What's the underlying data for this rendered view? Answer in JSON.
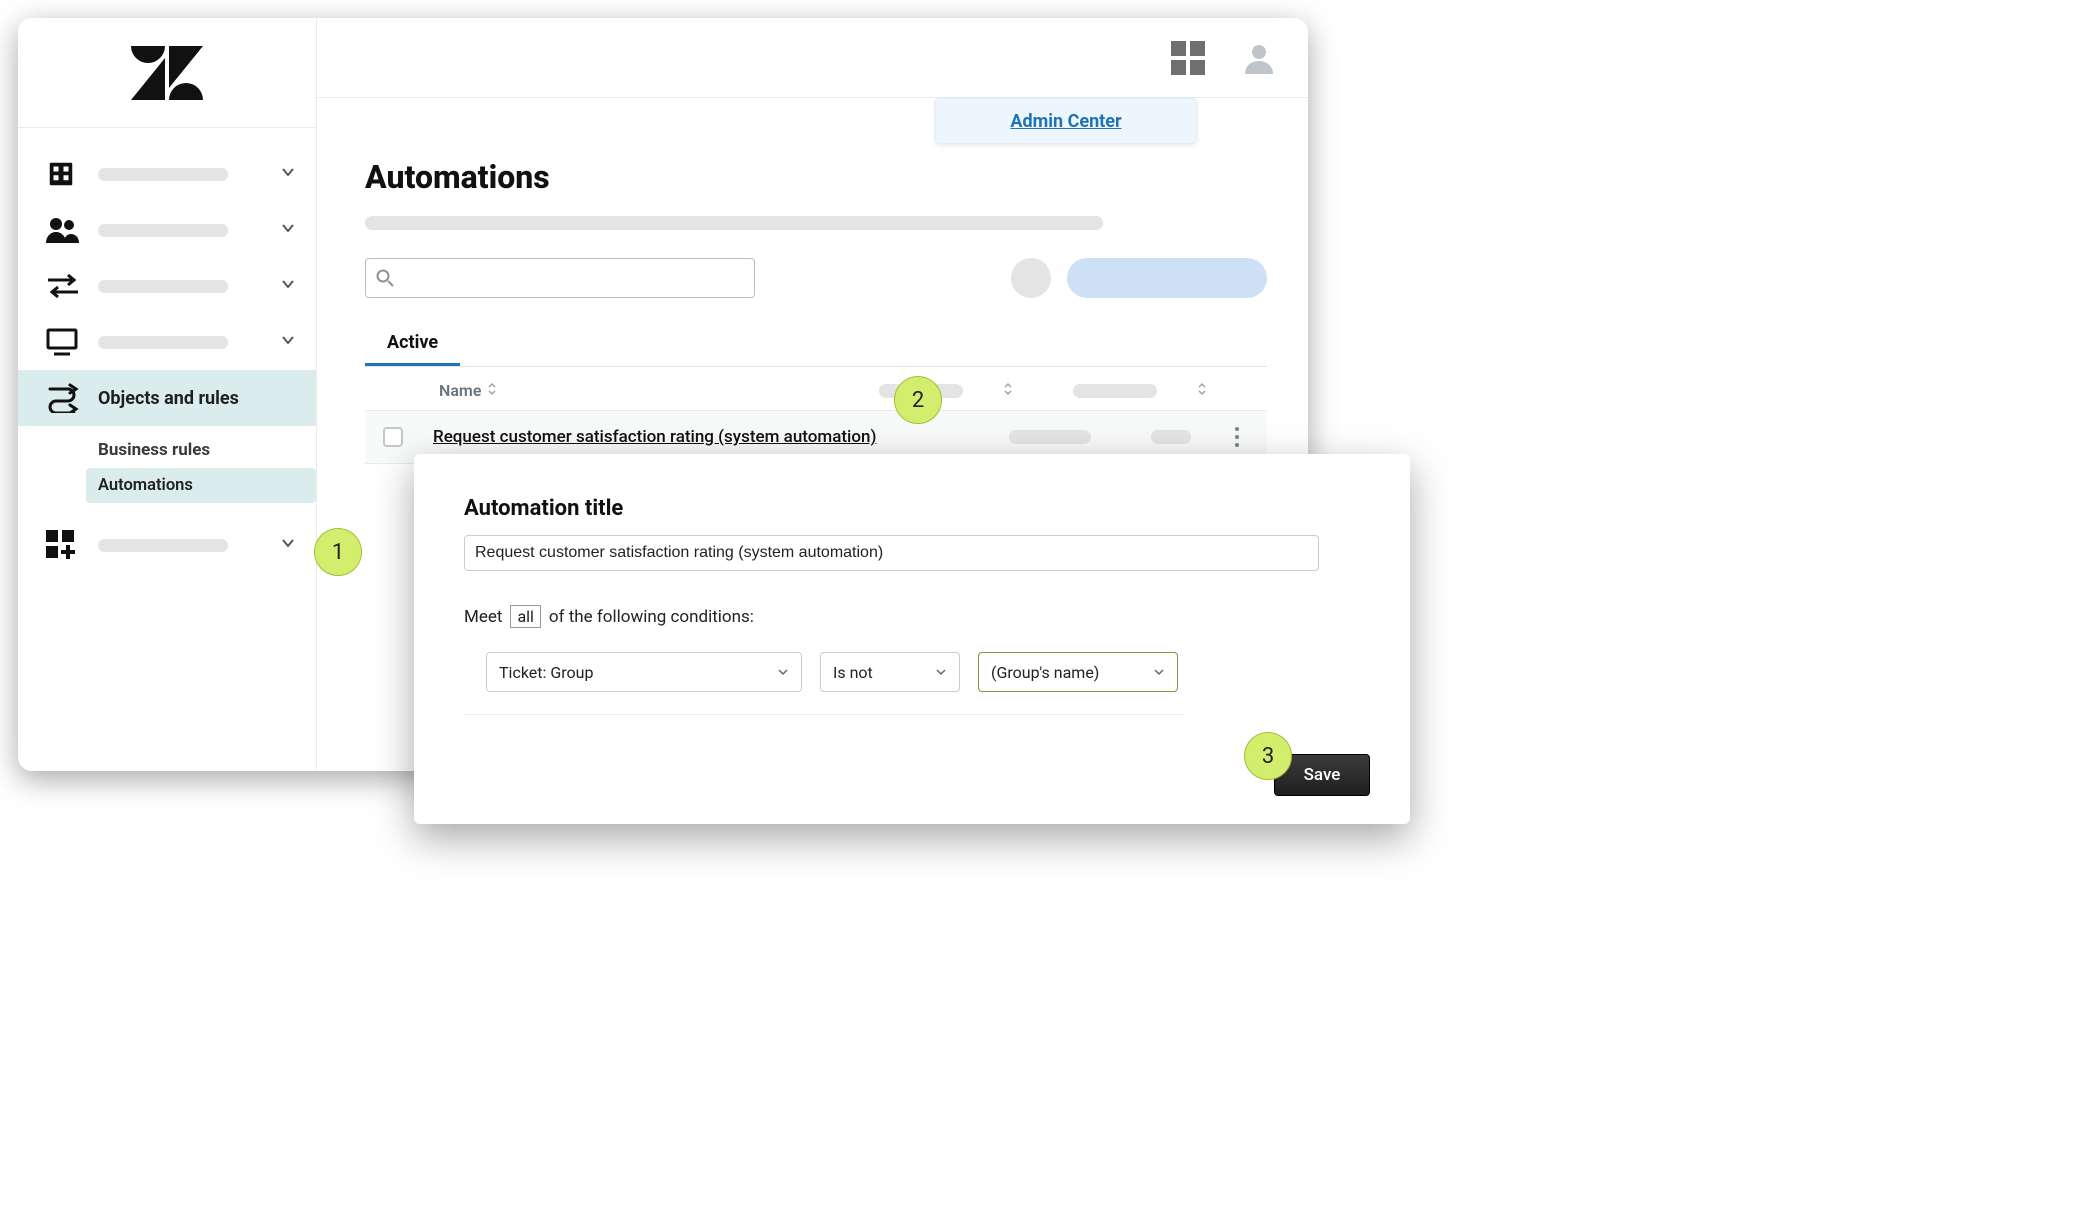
{
  "admin_center_label": "Admin Center",
  "sidebar": {
    "objects_rules_label": "Objects and rules",
    "business_rules_label": "Business rules",
    "automations_label": "Automations"
  },
  "page": {
    "title": "Automations",
    "tab_active": "Active",
    "col_name": "Name",
    "row_link": "Request customer satisfaction rating (system automation)"
  },
  "overlay": {
    "title": "Automation title",
    "title_value": "Request customer satisfaction rating (system automation)",
    "meet_prefix": "Meet",
    "meet_all": "all",
    "meet_suffix": "of the following conditions:",
    "cond_field": "Ticket: Group",
    "cond_op": "Is not",
    "cond_value": "(Group's name)",
    "save": "Save"
  },
  "badges": {
    "b1": "1",
    "b2": "2",
    "b3": "3"
  }
}
